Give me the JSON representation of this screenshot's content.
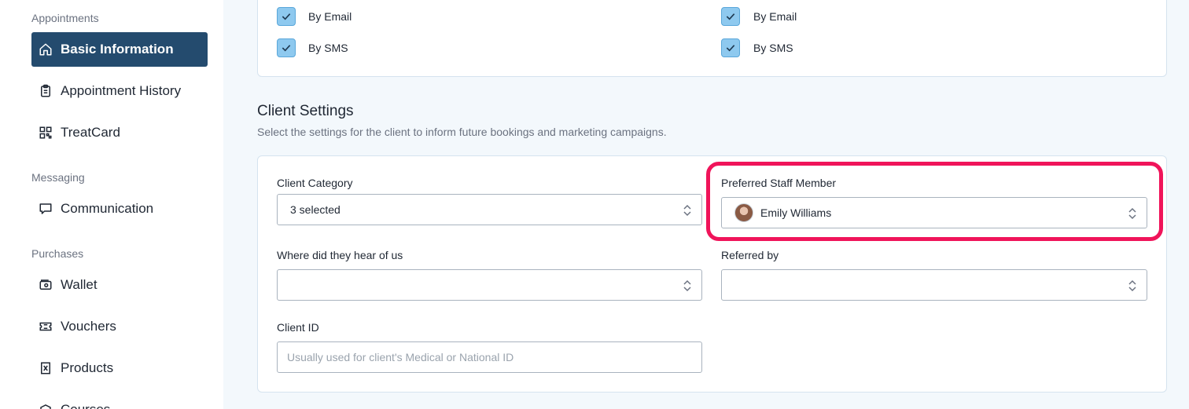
{
  "sidebar": {
    "sections": {
      "appointments": "Appointments",
      "messaging": "Messaging",
      "purchases": "Purchases"
    },
    "items": [
      {
        "label": "Basic Information",
        "icon": "home-icon",
        "active": true
      },
      {
        "label": "Appointment History",
        "icon": "clipboard-icon"
      },
      {
        "label": "TreatCard",
        "icon": "qr-code-icon"
      },
      {
        "label": "Communication",
        "icon": "message-icon"
      },
      {
        "label": "Wallet",
        "icon": "wallet-icon"
      },
      {
        "label": "Vouchers",
        "icon": "ticket-icon"
      },
      {
        "label": "Products",
        "icon": "receipt-icon"
      },
      {
        "label": "Courses",
        "icon": "box-icon"
      }
    ]
  },
  "notifications": {
    "left": [
      {
        "label": "By Email",
        "checked": true
      },
      {
        "label": "By SMS",
        "checked": true
      }
    ],
    "right": [
      {
        "label": "By Email",
        "checked": true
      },
      {
        "label": "By SMS",
        "checked": true
      }
    ]
  },
  "client_settings": {
    "title": "Client Settings",
    "subtitle": "Select the settings for the client to inform future bookings and marketing campaigns.",
    "client_category": {
      "label": "Client Category",
      "value": "3 selected"
    },
    "preferred_staff": {
      "label": "Preferred Staff Member",
      "value": "Emily Williams"
    },
    "heard_of_us": {
      "label": "Where did they hear of us",
      "value": ""
    },
    "referred_by": {
      "label": "Referred by",
      "value": ""
    },
    "client_id": {
      "label": "Client ID",
      "placeholder": "Usually used for client's Medical or National ID"
    }
  },
  "colors": {
    "accent": "#244b6e",
    "checkbox": "#8ec9ef",
    "highlight": "#f0145a",
    "background": "#f3f8fc"
  }
}
